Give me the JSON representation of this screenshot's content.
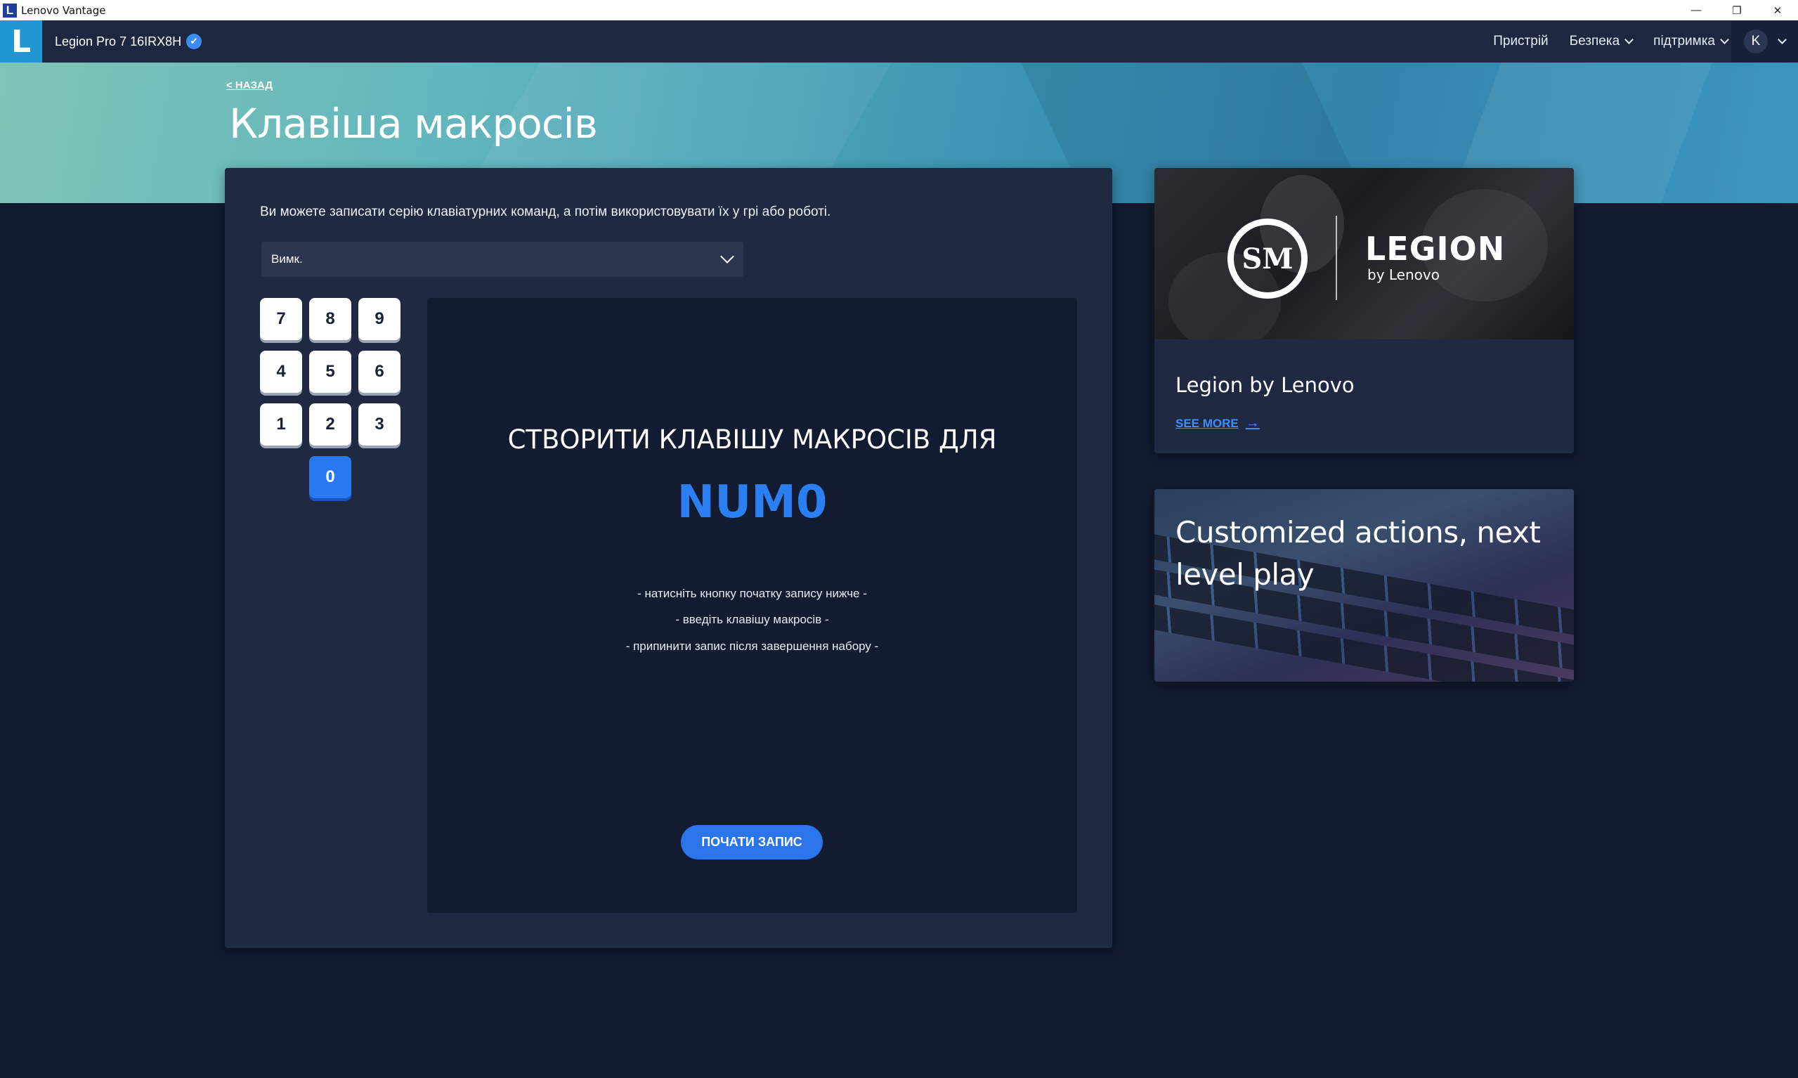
{
  "window": {
    "title": "Lenovo Vantage",
    "app_icon_letter": "L",
    "minimize": "—",
    "restore": "❐",
    "close": "✕"
  },
  "header": {
    "logo_letter": "L",
    "device_name": "Legion Pro 7 16IRX8H",
    "nav": {
      "device": "Пристрій",
      "security": "Безпека",
      "support": "підтримка"
    },
    "user_initial": "K"
  },
  "page": {
    "back_label": "< НАЗАД",
    "title": "Клавіша макросів"
  },
  "main": {
    "description": "Ви можете записати серію клавіатурних команд, а потім використовувати їх у грі або роботі.",
    "dropdown_value": "Вимк.",
    "keys": [
      "7",
      "8",
      "9",
      "4",
      "5",
      "6",
      "1",
      "2",
      "3",
      "0"
    ],
    "active_key": "0",
    "record": {
      "heading": "СТВОРИТИ КЛАВІШУ МАКРОСІВ ДЛЯ",
      "key_name": "NUM0",
      "instructions": [
        "- натисніть кнопку початку запису нижче -",
        "- введіть клавішу макросів -",
        "- припинити запис після завершення набору -"
      ],
      "start_button": "ПОЧАТИ ЗАПИС"
    }
  },
  "cards": {
    "legion": {
      "logo_left": "SM",
      "logo_word": "LEGION",
      "logo_sub": "by Lenovo",
      "title": "Legion by Lenovo",
      "link": "SEE MORE",
      "arrow": "→"
    },
    "keyboard": {
      "title": "Customized actions, next level play"
    }
  },
  "colors": {
    "accent": "#2a78f0",
    "background": "#121a2e",
    "panel": "#1f2942"
  }
}
